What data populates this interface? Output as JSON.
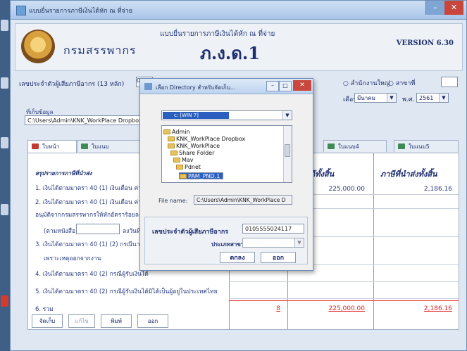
{
  "window": {
    "title": "แบบยื่นรายการภาษีเงินได้หัก ณ ที่จ่าย",
    "min_glyph": "–",
    "close_glyph": "✕"
  },
  "header": {
    "agency": "กรมสรรพากร",
    "form_subtitle": "แบบยื่นรายการภาษีเงินได้หัก ณ ที่จ่าย",
    "form_code": "ภ.ง.ด.1",
    "version": "VERSION 6.30"
  },
  "taxpayer": {
    "tax_id_label": "เลขประจำตัวผู้เสียภาษีอากร (13 หลัก)",
    "tax_id_value": "010",
    "branch_option1": "สำนักงานใหญ่",
    "branch_option2": "สาขาที่",
    "month_label": "เดือน",
    "month_value": "มีนาคม",
    "year_label": "พ.ศ.",
    "year_value": "2561"
  },
  "location": {
    "label": "ที่เก็บข้อมูล",
    "value": "C:\\Users\\Admin\\KNK_WorkPlace Dropbox"
  },
  "tabs": [
    {
      "label": "ใบหน้า"
    },
    {
      "label": "ใบแนบ"
    },
    {
      "label": "ใบแนบ4"
    },
    {
      "label": "ใบแนบ5"
    }
  ],
  "summary": {
    "section_title": "สรุปรายการภาษีที่นำส่ง",
    "col_income": "เงินได้ทั้งสิ้น",
    "col_tax": "ภาษีที่นำส่งทั้งสิ้น",
    "lines": [
      "1. เงินได้ตามมาตรา 40 (1) เงินเดือน ค่าจ้าง",
      "2. เงินได้ตามมาตรา 40 (1) เงินเดือน ค่าจ้าง",
      "อนุมัติจากกรมสรรพากรให้หักอัตราร้อยละ",
      "(ตามหนังสือ",
      "3. เงินได้ตามมาตรา 40 (1) (2) กรณีนายจ้าง",
      "เพราะเหตุออกจากงาน",
      "4. เงินได้ตามมาตรา 40 (2) กรณีผู้รับเงินได้",
      "5. เงินได้ตามมาตรา 40 (2) กรณีผู้รับเงินได้มิได้เป็นผู้อยู่ในประเทศไทย",
      "6. รวม"
    ],
    "line_extra": "ลงวันที่",
    "row1_income": "225,000.00",
    "row1_tax": "2,186.16",
    "total_count": "8",
    "total_income": "225,000.00",
    "total_tax": "2,186.16"
  },
  "bottom_buttons": {
    "save": "จัดเก็บ",
    "b2": "แก้ไข",
    "print": "พิมพ์",
    "exit": "ออก"
  },
  "dialog": {
    "title": "เลือก Directory สำหรับจัดเก็บ...",
    "drive": "c: [WIN 7]",
    "folders": [
      "Admin",
      "KNK_WorkPlace Dropbox",
      "KNK_WorkPlace",
      "Share Folder",
      "Mav",
      "Pdnet",
      "PAM_PND.1"
    ],
    "file_name_label": "File name:",
    "file_name_value": "C:\\Users\\Admin\\KNK_WorkPlace D",
    "tax_id_label": "เลขประจำตัวผู้เสียภาษีอากร",
    "tax_id_value": "0105555024117",
    "branch_type_label": "ประเภทสาขา",
    "ok": "ตกลง",
    "cancel": "ออก"
  }
}
